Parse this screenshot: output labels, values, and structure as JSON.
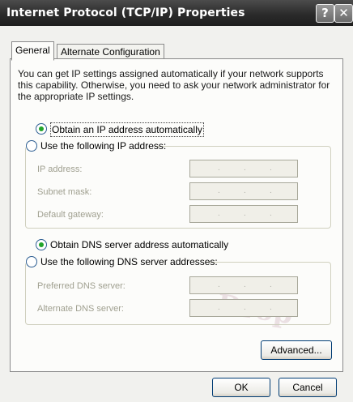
{
  "window": {
    "title": "Internet Protocol (TCP/IP) Properties",
    "help_glyph": "?",
    "close_glyph": "✕"
  },
  "tabs": [
    "General",
    "Alternate Configuration"
  ],
  "description": "You can get IP settings assigned automatically if your network supports this capability. Otherwise, you need to ask your network administrator for the appropriate IP settings.",
  "ip": {
    "auto_label": "Obtain an IP address automatically",
    "auto_selected": true,
    "manual_label": "Use the following IP address:",
    "fields": [
      {
        "label": "IP address:"
      },
      {
        "label": "Subnet mask:"
      },
      {
        "label": "Default gateway:"
      }
    ]
  },
  "dns": {
    "auto_label": "Obtain DNS server address automatically",
    "auto_selected": true,
    "manual_label": "Use the following DNS server addresses:",
    "fields": [
      {
        "label": "Preferred DNS server:"
      },
      {
        "label": "Alternate DNS server:"
      }
    ]
  },
  "buttons": {
    "advanced": "Advanced...",
    "ok": "OK",
    "cancel": "Cancel"
  },
  "watermark": "Drop"
}
